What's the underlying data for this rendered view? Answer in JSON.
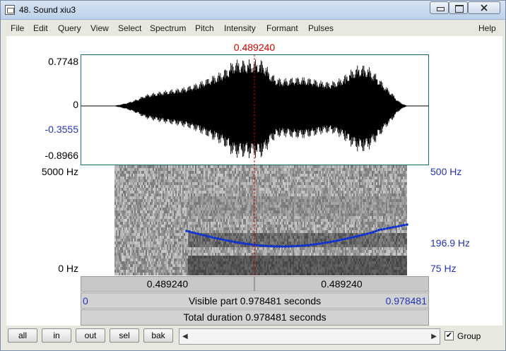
{
  "window": {
    "title": "48. Sound xiu3",
    "ghost_text": "··· ··· ···· ··· ···· ···· ··· ····"
  },
  "menu": [
    "File",
    "Edit",
    "Query",
    "View",
    "Select",
    "Spectrum",
    "Pitch",
    "Intensity",
    "Formant",
    "Pulses",
    "Help"
  ],
  "cursor": {
    "time": "0.489240",
    "color": "#d00000"
  },
  "waveform": {
    "y_labels": {
      "max": "0.7748",
      "zero": "0",
      "cursor": "-0.3555",
      "min": "-0.8966"
    }
  },
  "spectrogram": {
    "left_labels": {
      "top": "5000 Hz",
      "bottom": "0 Hz"
    },
    "right_labels": {
      "top": "500 Hz",
      "pitch": "196.9 Hz",
      "bottom": "75 Hz"
    }
  },
  "time_bars": {
    "left_segment": "0.489240",
    "right_segment": "0.489240",
    "visible_start": "0",
    "visible_label": "Visible part 0.978481 seconds",
    "visible_end": "0.978481",
    "total_label": "Total duration 0.978481 seconds"
  },
  "buttons": {
    "all": "all",
    "in": "in",
    "out": "out",
    "sel": "sel",
    "bak": "bak"
  },
  "group": {
    "label": "Group",
    "checked": "✔"
  },
  "colors": {
    "label_blue": "#2233bb",
    "pitch_blue": "#1133cc",
    "frame": "#0f6a6a"
  }
}
